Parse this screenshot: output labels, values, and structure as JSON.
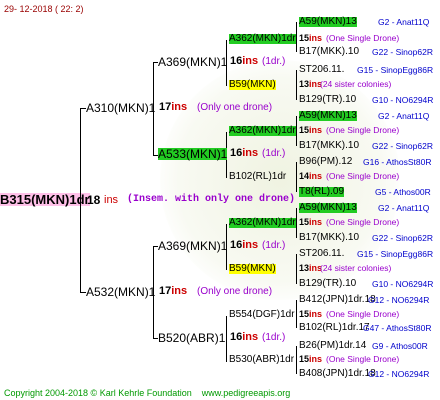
{
  "header": {
    "date": "29- 12-2018 ( 22: 2)"
  },
  "root": {
    "name": "B315(MKN)1dr",
    "ins_num": "18",
    "ins_unit": "ins",
    "note": "(Insem. with only one drone)"
  },
  "nodes": [
    {
      "id": "a310",
      "name": "A310(MKN)1",
      "ins_num": "17",
      "ins_unit": "ins",
      "note": "(Only one drone)"
    },
    {
      "id": "a532",
      "name": "A532(MKN)1",
      "ins_num": "17",
      "ins_unit": "ins",
      "note": "(Only one drone)"
    },
    {
      "id": "a369a",
      "name": "A369(MKN)1",
      "ins_num": "16",
      "ins_unit": "ins",
      "note": "(1dr.)"
    },
    {
      "id": "a533",
      "name": "A533(MKN)1",
      "ins_num": "16",
      "ins_unit": "ins",
      "note": "(1dr.)"
    },
    {
      "id": "a369b",
      "name": "A369(MKN)1",
      "ins_num": "16",
      "ins_unit": "ins",
      "note": "(1dr.)"
    },
    {
      "id": "b520",
      "name": "B520(ABR)1",
      "ins_num": "16",
      "ins_unit": "ins",
      "note": "(1dr.)"
    }
  ],
  "level3": [
    {
      "name": "A362(MKN)1dr",
      "ins_num": "15",
      "ins_unit": "ins",
      "note": "(One Single Drone)"
    },
    {
      "name": "B59(MKN)",
      "ins_num": "13",
      "ins_unit": "ins",
      "note": "(24 sister colonies)"
    },
    {
      "name": "A362(MKN)1dr",
      "ins_num": "15",
      "ins_unit": "ins",
      "note": "(One Single Drone)"
    },
    {
      "name": "B102(RL)1dr",
      "ins_num": "14",
      "ins_unit": "ins",
      "note": "(One Single Drone)"
    },
    {
      "name": "A362(MKN)1dr",
      "ins_num": "15",
      "ins_unit": "ins",
      "note": "(One Single Drone)"
    },
    {
      "name": "B59(MKN)",
      "ins_num": "13",
      "ins_unit": "ins",
      "note": "(24 sister colonies)"
    },
    {
      "name": "B554(DGF)1dr",
      "ins_num": "15",
      "ins_unit": "ins",
      "note": "(One Single Drone)"
    },
    {
      "name": "B530(ABR)1dr",
      "ins_num": "15",
      "ins_unit": "ins",
      "note": "(One Single Drone)"
    }
  ],
  "leaves": [
    {
      "name": "A59(MKN)13",
      "right": "G2 - Anat11Q"
    },
    {
      "name": "B17(MKK).10",
      "right": "G22 - Sinop62R"
    },
    {
      "name": "ST206.11.",
      "right": "G15 - SinopEgg86R"
    },
    {
      "name": "B129(TR).10",
      "right": "G10 - NO6294R"
    },
    {
      "name": "A59(MKN)13",
      "right": "G2 - Anat11Q"
    },
    {
      "name": "B17(MKK).10",
      "right": "G22 - Sinop62R"
    },
    {
      "name": "B96(PM).12",
      "right": "G16 - AthosSt80R"
    },
    {
      "name": "T8(RL).09",
      "right": "G5 - Athos00R"
    },
    {
      "name": "A59(MKN)13",
      "right": "G2 - Anat11Q"
    },
    {
      "name": "B17(MKK).10",
      "right": "G22 - Sinop62R"
    },
    {
      "name": "ST206.11.",
      "right": "G15 - SinopEgg86R"
    },
    {
      "name": "B129(TR).10",
      "right": "G10 - NO6294R"
    },
    {
      "name": "B412(JPN)1dr.18",
      "right": "G12 - NO6294R"
    },
    {
      "name": "B102(RL)1dr.17",
      "right": "G47 - AthosSt80R"
    },
    {
      "name": "B26(PM)1dr.14",
      "right": "G9 - Athos00R"
    },
    {
      "name": "B408(JPN)1dr.18",
      "right": "G12 - NO6294R"
    }
  ],
  "footer": {
    "copyright": "Copyright 2004-2018 © Karl Kehrle Foundation",
    "url": "www.pedigreeapis.org"
  },
  "colors": {
    "green": "#22cc22",
    "yellow": "#ffff00",
    "pink": "#ffc0e8",
    "red": "#cc0000",
    "purple": "#9900cc",
    "blue": "#0000cc"
  }
}
